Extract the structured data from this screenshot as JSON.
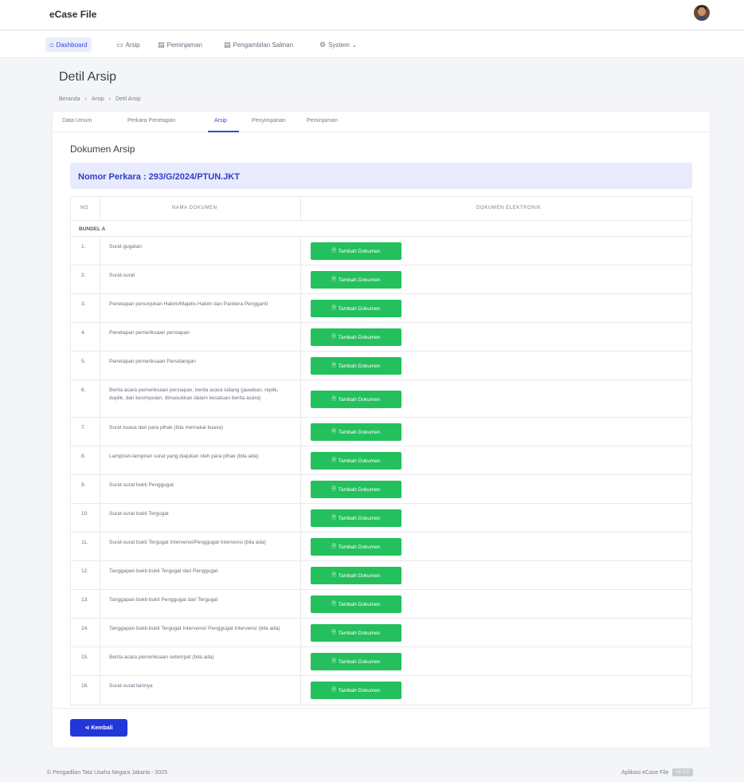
{
  "app": {
    "title": "eCase File"
  },
  "nav": {
    "items": [
      {
        "label": "Dashboard",
        "icon": "home-icon",
        "glyph": "⌂"
      },
      {
        "label": "Arsip",
        "icon": "archive-icon",
        "glyph": "▭"
      },
      {
        "label": "Peminjaman",
        "icon": "document-icon",
        "glyph": "▤"
      },
      {
        "label": "Pengambilan Salinan",
        "icon": "document-icon",
        "glyph": "▤"
      },
      {
        "label": "System",
        "icon": "gear-icon",
        "glyph": "⚙"
      }
    ],
    "chevron": "⌄"
  },
  "page": {
    "title": "Detil Arsip",
    "breadcrumb": [
      "Beranda",
      "›",
      "Arsip",
      "›",
      "Detil Arsip"
    ]
  },
  "tabs": [
    "Data Umum",
    "Perkara Penetapan",
    "Arsip",
    "Penyimpanan",
    "Peminjaman"
  ],
  "section": {
    "title": "Dokumen Arsip",
    "case_label": "Nomor Perkara : 293/G/2024/PTUN.JKT"
  },
  "table": {
    "headers": {
      "no": "NO",
      "name": "NAMA DOKUMEN",
      "file": "DOKUMEN ELEKTRONIK"
    },
    "group": "BUNDEL A",
    "button_label": "Tambah Dokumen",
    "rows": [
      {
        "no": "1.",
        "name": "Surat gugatan"
      },
      {
        "no": "2.",
        "name": "Surat-surat"
      },
      {
        "no": "3.",
        "name": "Penetapan penunjukan Hakim/Majelis Hakim dan Panitera Pengganti"
      },
      {
        "no": "4.",
        "name": "Penetapan pemeriksaan persiapan"
      },
      {
        "no": "5.",
        "name": "Penetapan pemeriksaan Persidangan"
      },
      {
        "no": "6.",
        "name": "Berita acara pemeriksaan persiapan, berita acara sidang (jawaban, replik, duplik, dan kesimpulan, dimasukkan dalam kesatuan berita acara)"
      },
      {
        "no": "7.",
        "name": "Surat kuasa dari para pihak (bila memakai kuasa)"
      },
      {
        "no": "8.",
        "name": "Lampiran-lampiran surat yang diajukan oleh para pihak (bila ada)"
      },
      {
        "no": "9.",
        "name": "Surat-surat bukti Penggugat"
      },
      {
        "no": "10.",
        "name": "Surat-surat bukti Tergugat"
      },
      {
        "no": "11.",
        "name": "Surat-surat bukti Tergugat Intervensi/Penggugat Intervensi (bila ada)"
      },
      {
        "no": "12.",
        "name": "Tanggapan bukti-bukti Tergugat dari Penggugat"
      },
      {
        "no": "13.",
        "name": "Tanggapan bukti-bukti Penggugat dari Tergugat"
      },
      {
        "no": "14.",
        "name": "Tanggapan bukti-bukti Tergugat Intervensi/ Penggugat Intervensi (bila ada)"
      },
      {
        "no": "15.",
        "name": "Berita acara pemeriksaan setempat (bila ada)"
      },
      {
        "no": "16.",
        "name": "Surat-surat lainnya"
      }
    ]
  },
  "back_button": {
    "label": "Kembali",
    "glyph": "⊲"
  },
  "footer": {
    "left": "© Pengadilan Tata Usaha Negara Jakarta - 2025",
    "right": "Aplikasi eCase File",
    "version": "v1.0.0"
  },
  "colors": {
    "primary": "#2237d9",
    "success": "#23c05d",
    "case_bg": "#e8eafd"
  }
}
